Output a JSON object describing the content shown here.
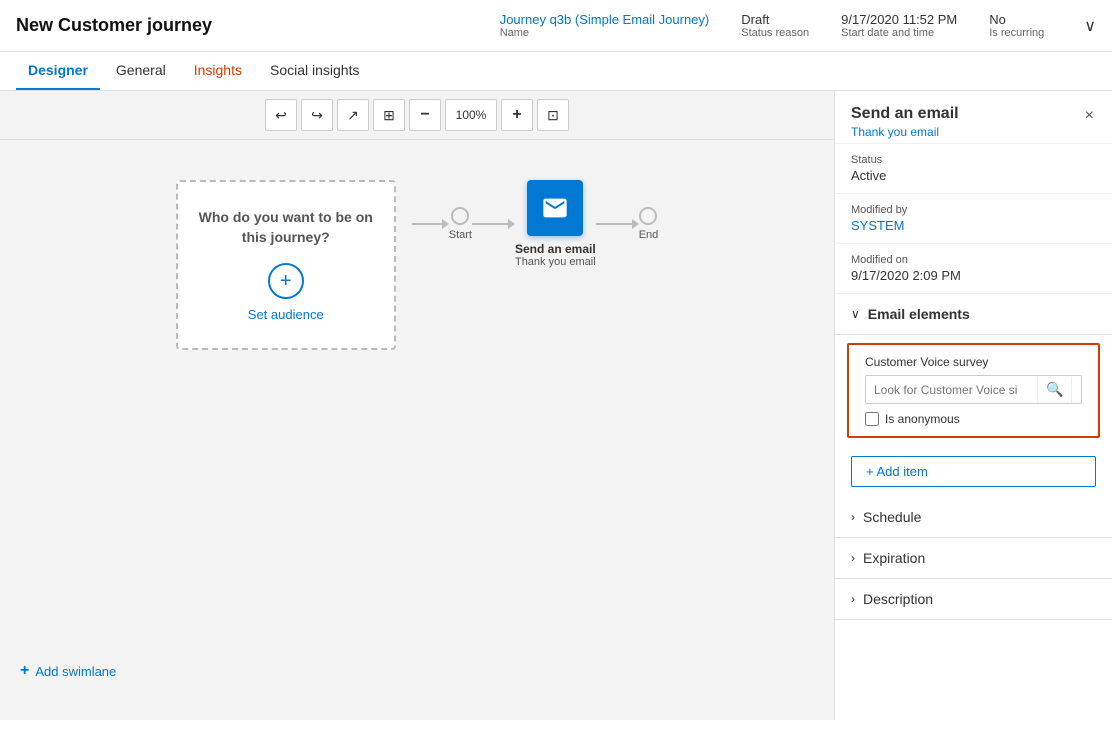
{
  "header": {
    "title": "New Customer journey",
    "meta": {
      "name_label": "Name",
      "name_value": "Journey q3b (Simple Email Journey)",
      "status_label": "Status reason",
      "status_value": "Draft",
      "date_label": "Start date and time",
      "date_value": "9/17/2020 11:52 PM",
      "recurring_label": "Is recurring",
      "recurring_value": "No"
    }
  },
  "tabs": [
    {
      "id": "designer",
      "label": "Designer",
      "active": true,
      "highlight": false
    },
    {
      "id": "general",
      "label": "General",
      "active": false,
      "highlight": false
    },
    {
      "id": "insights",
      "label": "Insights",
      "active": false,
      "highlight": true
    },
    {
      "id": "social_insights",
      "label": "Social insights",
      "active": false,
      "highlight": false
    }
  ],
  "toolbar": {
    "undo": "↩",
    "redo": "↪",
    "expand": "↗",
    "grid": "⊞",
    "zoom_out": "−",
    "zoom_level": "100%",
    "zoom_in": "+",
    "fit": "⊡"
  },
  "canvas": {
    "swimlane_text": "Who do you want to be on this journey?",
    "set_audience": "Set audience",
    "start_label": "Start",
    "end_label": "End",
    "email_node_title": "Send an email",
    "email_node_sub": "Thank you email",
    "add_swimlane": "Add swimlane"
  },
  "panel": {
    "title": "Send an email",
    "subtitle": "Thank you email",
    "status_label": "Status",
    "status_value": "Active",
    "modified_by_label": "Modified by",
    "modified_by_value": "SYSTEM",
    "modified_on_label": "Modified on",
    "modified_on_value": "9/17/2020 2:09 PM",
    "email_elements_label": "Email elements",
    "cv_survey_label": "Customer Voice survey",
    "cv_search_placeholder": "Look for Customer Voice si",
    "is_anonymous_label": "Is anonymous",
    "add_item_label": "+ Add item",
    "schedule_label": "Schedule",
    "expiration_label": "Expiration",
    "description_label": "Description"
  },
  "icons": {
    "chevron_down": "∨",
    "chevron_right": "›",
    "chevron_left": "‹",
    "close": "×",
    "search": "🔍",
    "plus": "+",
    "email": "✉"
  }
}
